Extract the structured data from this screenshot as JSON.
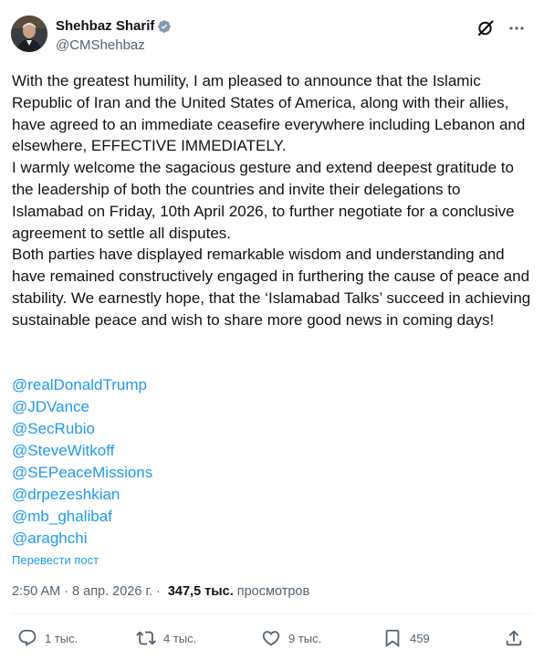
{
  "author": {
    "display_name": "Shehbaz Sharif",
    "handle": "@CMShehbaz"
  },
  "body": {
    "p1": "With the greatest humility, I am pleased to announce that the Islamic Republic of Iran and the United States of America, along with their allies, have agreed to an immediate ceasefire everywhere including Lebanon and elsewhere, EFFECTIVE IMMEDIATELY.",
    "p2": "I warmly welcome the sagacious gesture and extend deepest gratitude to the leadership of both the countries and invite their delegations to Islamabad on Friday, 10th April 2026, to further negotiate for a conclusive agreement to settle all disputes.",
    "p3": "Both parties have displayed remarkable wisdom and understanding and have remained constructively engaged in furthering the cause of peace and stability. We earnestly hope, that the ‘Islamabad Talks’ succeed in achieving sustainable peace and wish to share more good news in coming days!"
  },
  "mentions": [
    "@realDonaldTrump",
    "@JDVance",
    "@SecRubio",
    "@SteveWitkoff",
    "@SEPeaceMissions",
    "@drpezeshkian",
    "@mb_ghalibaf",
    "@araghchi"
  ],
  "translate_label": "Перевести пост",
  "meta": {
    "time": "2:50 AM",
    "separator": "·",
    "date": "8 апр. 2026 г.",
    "views_count": "347,5 тыс.",
    "views_label": "просмотров"
  },
  "actions": {
    "replies": "1 тыс.",
    "reposts": "4 тыс.",
    "likes": "9 тыс.",
    "bookmarks": "459"
  },
  "colors": {
    "accent": "#1d9bf0",
    "text": "#0f1419",
    "secondary": "#536471",
    "verified": "#829aab"
  },
  "icons": [
    "verified-badge-icon",
    "grok-icon",
    "more-icon",
    "reply-icon",
    "repost-icon",
    "like-icon",
    "bookmark-icon",
    "share-icon"
  ]
}
